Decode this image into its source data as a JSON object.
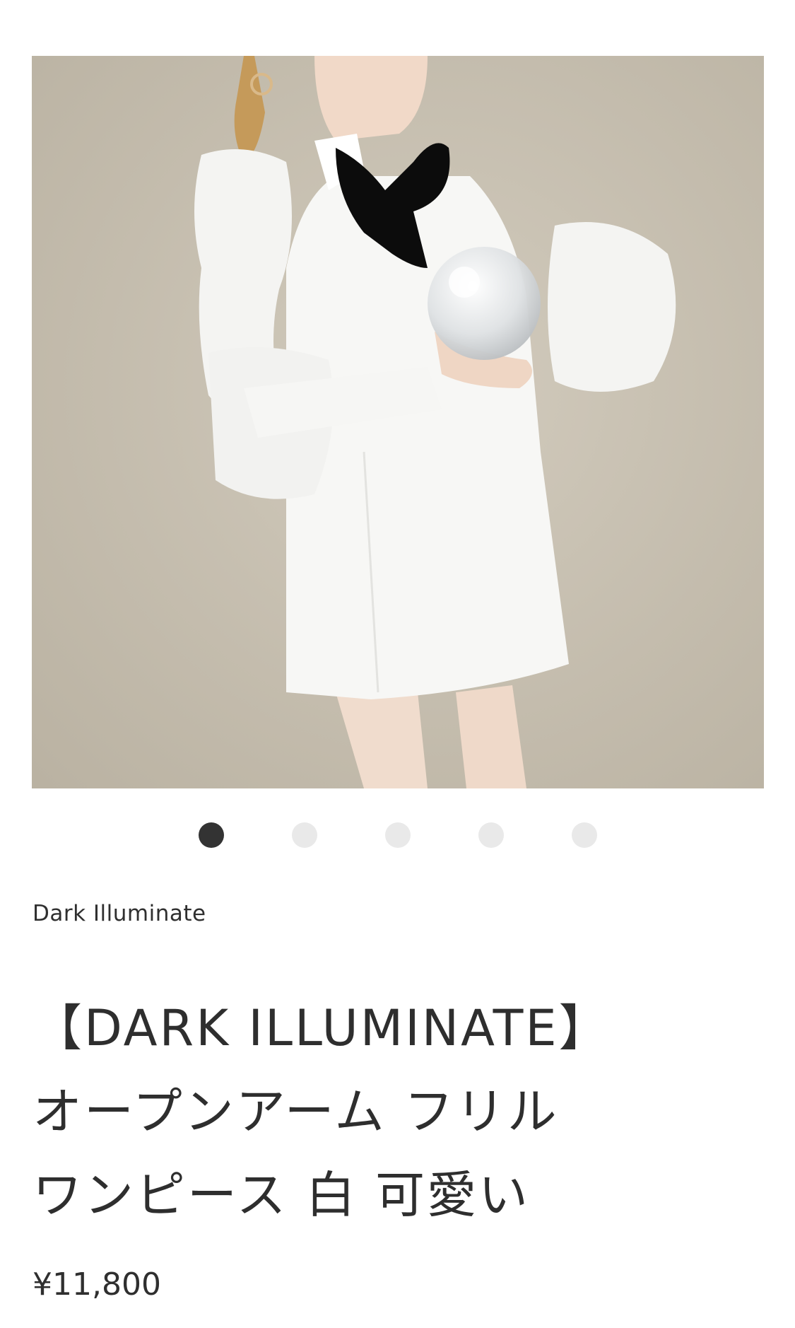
{
  "product": {
    "vendor": "Dark Illuminate",
    "title_line1": "【DARK ILLUMINATE】",
    "title_line2": "オープンアーム フリル",
    "title_line3": "ワンピース 白 可愛い",
    "price": "¥11,800"
  },
  "gallery": {
    "slide_count": 5,
    "active_slide": 1,
    "image_subject": "model in white ruffled open-arm dress with black bow holding glass sphere"
  },
  "colors": {
    "dot_active": "#333333",
    "dot_inactive": "#e9e9e9",
    "text": "#2e2e2e",
    "backdrop": "#c9c2b3"
  }
}
